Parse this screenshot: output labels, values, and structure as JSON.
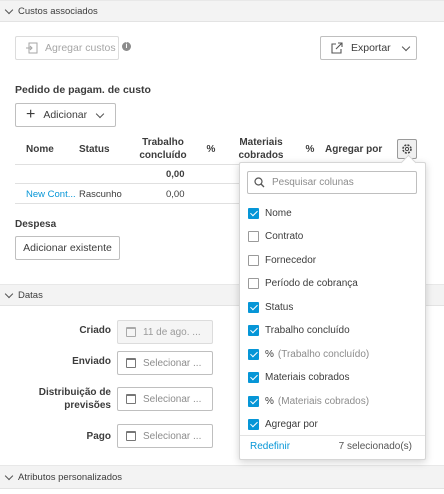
{
  "sections": {
    "custos": "Custos associados",
    "datas": "Datas",
    "atributos": "Atributos personalizados"
  },
  "toolbar": {
    "agregar_label": "Agregar custos",
    "exportar_label": "Exportar"
  },
  "pedido": {
    "title": "Pedido de pagam. de custo",
    "adicionar_label": "Adicionar"
  },
  "table": {
    "headers": {
      "nome": "Nome",
      "status": "Status",
      "trabalho": "Trabalho concluído",
      "pct1": "%",
      "materiais": "Materiais cobrados",
      "pct2": "%",
      "agregar": "Agregar por"
    },
    "totals": {
      "trabalho": "0,00"
    },
    "row": {
      "nome": "New Cont...",
      "status": "Rascunho",
      "trabalho": "0,00"
    }
  },
  "despesa": {
    "title": "Despesa",
    "add_label": "Adicionar existente"
  },
  "datas": {
    "criado_label": "Criado",
    "criado_value": "11 de ago. ...",
    "enviado_label": "Enviado",
    "distribuicao_label": "Distribuição de previsões",
    "pago_label": "Pago",
    "select_placeholder": "Selecionar ..."
  },
  "column_picker": {
    "search_placeholder": "Pesquisar colunas",
    "options": [
      {
        "label": "Nome",
        "checked": true,
        "suffix": ""
      },
      {
        "label": "Contrato",
        "checked": false,
        "suffix": ""
      },
      {
        "label": "Fornecedor",
        "checked": false,
        "suffix": ""
      },
      {
        "label": "Período de cobrança",
        "checked": false,
        "suffix": ""
      },
      {
        "label": "Status",
        "checked": true,
        "suffix": ""
      },
      {
        "label": "Trabalho concluído",
        "checked": true,
        "suffix": ""
      },
      {
        "label": "%",
        "checked": true,
        "suffix": "(Trabalho concluído)"
      },
      {
        "label": "Materiais cobrados",
        "checked": true,
        "suffix": ""
      },
      {
        "label": "%",
        "checked": true,
        "suffix": "(Materiais cobrados)"
      },
      {
        "label": "Agregar por",
        "checked": true,
        "suffix": ""
      }
    ],
    "reset_label": "Redefinir",
    "selected_count": "7 selecionado(s)"
  },
  "colors": {
    "accent": "#0696d7",
    "link": "#0696d7"
  }
}
